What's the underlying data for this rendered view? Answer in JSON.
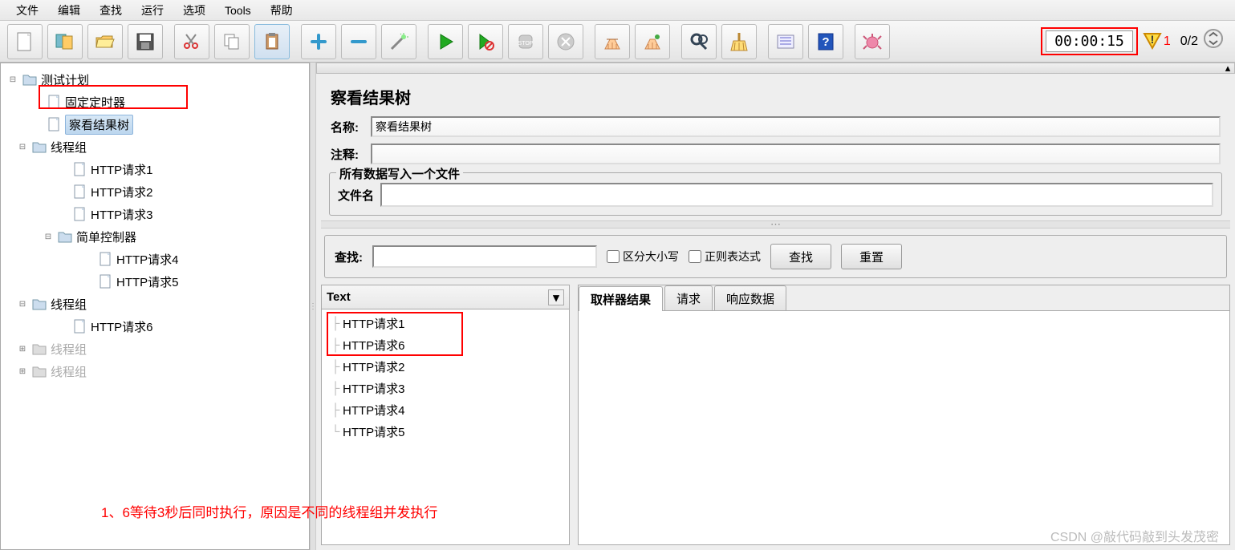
{
  "menu": [
    "文件",
    "编辑",
    "查找",
    "运行",
    "选项",
    "Tools",
    "帮助"
  ],
  "timer": "00:00:15",
  "errorCount": "1",
  "threadCounter": "0/2",
  "tree": {
    "root": "测试计划",
    "timerNode": "固定定时器",
    "viewTree": "察看结果树",
    "group1": "线程组",
    "req1": "HTTP请求1",
    "req2": "HTTP请求2",
    "req3": "HTTP请求3",
    "simple": "简单控制器",
    "req4": "HTTP请求4",
    "req5": "HTTP请求5",
    "group2": "线程组",
    "req6": "HTTP请求6",
    "group3": "线程组",
    "group4": "线程组"
  },
  "annotation": "1、6等待3秒后同时执行，原因是不同的线程组并发执行",
  "panel": {
    "title": "察看结果树",
    "nameLabel": "名称:",
    "nameValue": "察看结果树",
    "commentLabel": "注释:",
    "commentValue": "",
    "fileLegend": "所有数据写入一个文件",
    "fileLabel": "文件名",
    "fileValue": ""
  },
  "search": {
    "label": "查找:",
    "value": "",
    "caseLabel": "区分大小写",
    "regexLabel": "正则表达式",
    "findBtn": "查找",
    "resetBtn": "重置"
  },
  "results": {
    "header": "Text",
    "items": [
      "HTTP请求1",
      "HTTP请求6",
      "HTTP请求2",
      "HTTP请求3",
      "HTTP请求4",
      "HTTP请求5"
    ]
  },
  "tabs": {
    "sampler": "取样器结果",
    "request": "请求",
    "response": "响应数据"
  },
  "watermark": "CSDN @敲代码敲到头发茂密"
}
